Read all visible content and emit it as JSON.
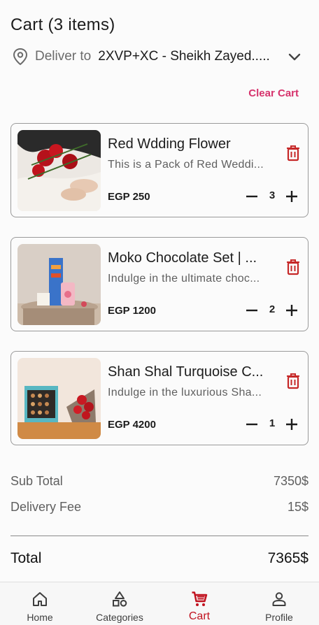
{
  "header": {
    "title": "Cart (3 items)"
  },
  "delivery": {
    "label": "Deliver to",
    "address": "2XVP+XC - Sheikh Zayed.....",
    "icon": "location-pin-icon",
    "expand_icon": "chevron-down-icon"
  },
  "clear_cart_label": "Clear Cart",
  "items": [
    {
      "name": "Red Wdding Flower",
      "description": "This is a Pack of Red Weddi...",
      "price": "EGP 250",
      "quantity": "3"
    },
    {
      "name": "Moko Chocolate Set | ...",
      "description": "Indulge in the ultimate choc...",
      "price": "EGP 1200",
      "quantity": "2"
    },
    {
      "name": "Shan Shal Turquoise C...",
      "description": "Indulge in the luxurious Sha...",
      "price": "EGP 4200",
      "quantity": "1"
    }
  ],
  "summary": {
    "subtotal_label": "Sub Total",
    "subtotal_value": "7350$",
    "delivery_label": "Delivery Fee",
    "delivery_value": "15$",
    "total_label": "Total",
    "total_value": "7365$"
  },
  "nav": [
    {
      "label": "Home",
      "icon": "home-icon"
    },
    {
      "label": "Categories",
      "icon": "categories-icon"
    },
    {
      "label": "Cart",
      "icon": "cart-icon",
      "active": true
    },
    {
      "label": "Profile",
      "icon": "profile-icon"
    }
  ],
  "colors": {
    "accent": "#c1121f",
    "clear_cart": "#d6336c",
    "trash": "#c62828"
  }
}
